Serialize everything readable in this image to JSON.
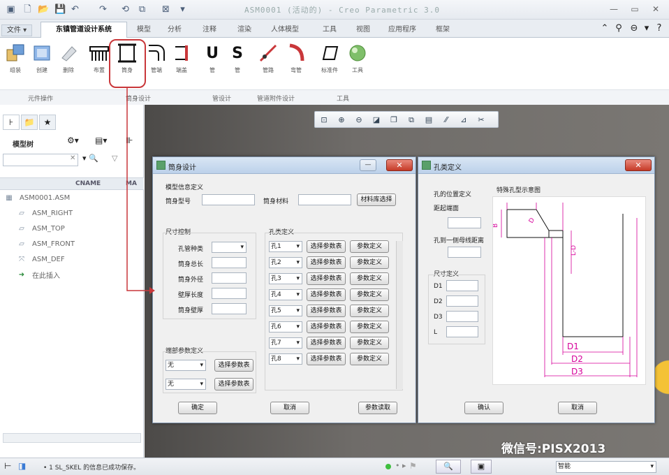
{
  "window": {
    "title": "ASM0001 (活动的) - Creo Parametric 3.0"
  },
  "tabs": {
    "file": "文件 ▾",
    "items": [
      "东镇管道设计系统",
      "模型",
      "分析",
      "注释",
      "渲染",
      "人体模型",
      "工具",
      "视图",
      "应用程序",
      "框架"
    ]
  },
  "ribbon": {
    "buttons": [
      {
        "label": "组装",
        "icon": "assemble-icon"
      },
      {
        "label": "创建",
        "icon": "create-icon"
      },
      {
        "label": "删除",
        "icon": "eraser-icon"
      },
      {
        "label": "布置",
        "icon": "manifold-icon"
      },
      {
        "label": "筒身",
        "icon": "cylinder-body-icon"
      },
      {
        "label": "管端",
        "icon": "elbow-icon"
      },
      {
        "label": "端盖",
        "icon": "end-cap-icon"
      },
      {
        "label": "U",
        "icon": "u-tube-icon"
      },
      {
        "label": "S",
        "icon": "s-tube-icon"
      },
      {
        "label": "管路",
        "icon": "pipe-route-icon"
      },
      {
        "label": "弯管",
        "icon": "bend-icon"
      },
      {
        "label": "标准件",
        "icon": "box-part-icon"
      },
      {
        "label": "工具",
        "icon": "sphere-tool-icon"
      }
    ],
    "groups": [
      "元件操作",
      "筒身设计",
      "管设计",
      "管道附件设计",
      "工具"
    ]
  },
  "model_tree": {
    "label": "模型树",
    "filter_placeholder": "",
    "col_name": "CNAME",
    "col_ma": "MA",
    "items": [
      {
        "label": "ASM0001.ASM",
        "icon": "assembly-icon"
      },
      {
        "label": "ASM_RIGHT",
        "icon": "datum-plane-icon"
      },
      {
        "label": "ASM_TOP",
        "icon": "datum-plane-icon"
      },
      {
        "label": "ASM_FRONT",
        "icon": "datum-plane-icon"
      },
      {
        "label": "ASM_DEF",
        "icon": "csys-icon"
      },
      {
        "label": "在此插入",
        "icon": "insert-here-icon"
      }
    ]
  },
  "dialog_main": {
    "title": "筒身设计",
    "section_model": "模型信息定义",
    "model_no_label": "筒身型号",
    "model_no_value": "",
    "material_label": "筒身材料",
    "material_value": "",
    "material_button": "材料库选择",
    "size_section": "尺寸控制",
    "size_fields": [
      "孔管种类",
      "筒身总长",
      "筒身外径",
      "壁厚长度",
      "筒身壁厚"
    ],
    "hole_section": "孔类定义",
    "hole_rows": [
      "孔1",
      "孔2",
      "孔3",
      "孔4",
      "孔5",
      "孔6",
      "孔7",
      "孔8"
    ],
    "select_param_btn": "选择参数表",
    "param_def_btn": "参数定义",
    "end_section": "端部参数定义",
    "end_rows": [
      "无",
      "无"
    ],
    "ok_btn": "确定",
    "cancel_btn": "取消",
    "param_read_btn": "参数读取"
  },
  "dialog_hole": {
    "title": "孔类定义",
    "pos_section": "孔的位置定义",
    "pos_field1": "距起端面",
    "pos_field2": "孔到一侧母线距离",
    "dim_section": "尺寸定义",
    "dim_fields": [
      "D1",
      "D2",
      "D3",
      "L"
    ],
    "diagram_title": "特殊孔型示意图",
    "ok_btn": "确认",
    "cancel_btn": "取消",
    "diagram_labels": [
      "D1",
      "D2",
      "D3",
      "L-D",
      "B",
      "D"
    ]
  },
  "status": {
    "message": "• 1 SL_SKEL 的信息已成功保存。",
    "mode": "智能"
  },
  "watermark": "微信号:PISX2013"
}
